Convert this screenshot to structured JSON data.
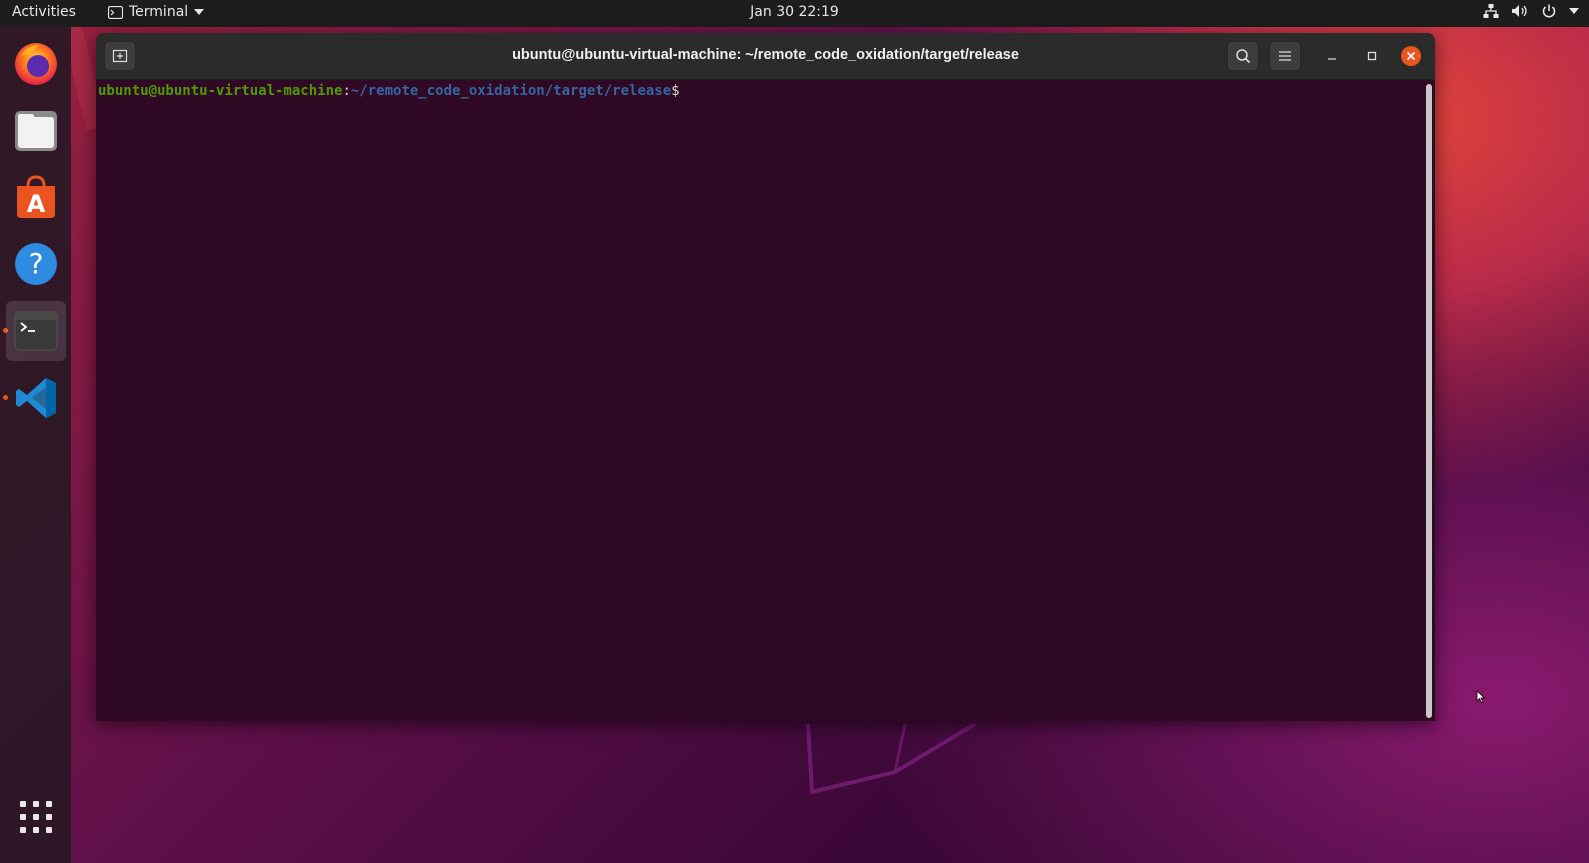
{
  "topbar": {
    "activities": "Activities",
    "app_name": "Terminal",
    "clock": "Jan 30  22:19"
  },
  "dock": {
    "items": [
      "firefox",
      "files",
      "software",
      "help",
      "terminal",
      "vscode"
    ],
    "show_apps_icon": "grid-icon"
  },
  "window": {
    "title": "ubuntu@ubuntu-virtual-machine: ~/remote_code_oxidation/target/release"
  },
  "terminal": {
    "prompt_user": "ubuntu@ubuntu-virtual-machine",
    "prompt_colon": ":",
    "prompt_path": "~/remote_code_oxidation/target/release",
    "prompt_symbol": "$"
  },
  "colors": {
    "terminal_bg": "#300a24",
    "accent": "#e95420",
    "prompt_user": "#4e9a06",
    "prompt_path": "#3465a4"
  }
}
